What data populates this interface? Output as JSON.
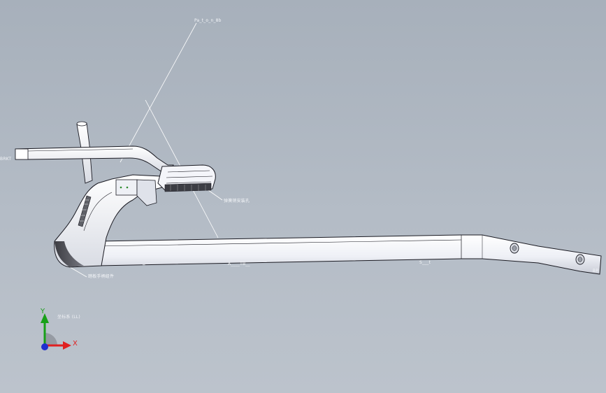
{
  "viewport": {
    "background_top": "#a7b0bb",
    "background_bottom": "#bcc3cc",
    "model_fill": "#f4f5fa",
    "model_edge": "#1a1a22"
  },
  "callouts": {
    "top": "Pa_t_o_n_8b",
    "left": "BRKT",
    "right": "BR",
    "mid": "弹簧销安装孔",
    "bottom_left": "踏板手柄组件",
    "center": "A____TB__",
    "right_bar": "S___t",
    "under_pivot": "─",
    "tiny_top": "..........",
    "coord_readout": "坐标系 (LL)"
  },
  "triad": {
    "x_label": "X",
    "y_label": "Y",
    "x_color": "#e02020",
    "y_color": "#18a018",
    "z_color": "#2030d0"
  }
}
